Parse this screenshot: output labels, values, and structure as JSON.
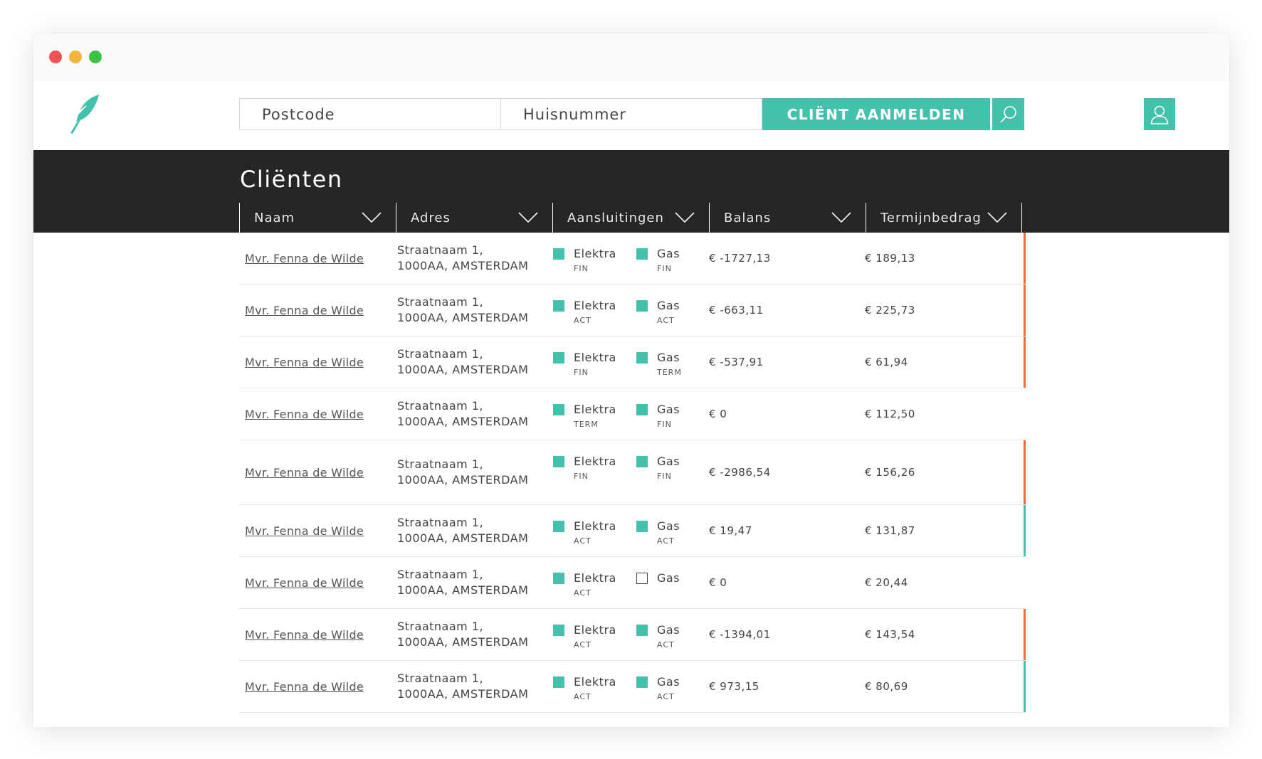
{
  "search": {
    "postcode_placeholder": "Postcode",
    "huisnummer_placeholder": "Huisnummer",
    "submit_label": "CLIËNT AANMELDEN"
  },
  "page": {
    "title": "Cliënten"
  },
  "columns": [
    "Naam",
    "Adres",
    "Aansluitingen",
    "Balans",
    "Termijnbedrag"
  ],
  "colors": {
    "brand": "#44c1aa",
    "negative_accent": "#f06a3c",
    "positive_accent": "#44c1aa",
    "dark_bar": "#262626"
  },
  "icons": {
    "logo": "feather-logo-icon",
    "search": "search-icon",
    "user": "user-icon",
    "sort": "chevron-down-icon",
    "connection": "status-square-icon"
  },
  "rows": [
    {
      "naam": "Mvr. Fenna de Wilde",
      "adres1": "Straatnaam 1,",
      "adres2": "1000AA, AMSTERDAM",
      "elektra": {
        "label": "Elektra",
        "status": "FIN",
        "active": true
      },
      "gas": {
        "label": "Gas",
        "status": "FIN",
        "active": true
      },
      "balans": "€ -1727,13",
      "termijn": "€ 189,13",
      "accent": "negative"
    },
    {
      "naam": "Mvr. Fenna de Wilde",
      "adres1": "Straatnaam 1,",
      "adres2": "1000AA, AMSTERDAM",
      "elektra": {
        "label": "Elektra",
        "status": "ACT",
        "active": true
      },
      "gas": {
        "label": "Gas",
        "status": "ACT",
        "active": true
      },
      "balans": "€ -663,11",
      "termijn": "€ 225,73",
      "accent": "negative"
    },
    {
      "naam": "Mvr. Fenna de Wilde",
      "adres1": "Straatnaam 1,",
      "adres2": "1000AA, AMSTERDAM",
      "elektra": {
        "label": "Elektra",
        "status": "FIN",
        "active": true
      },
      "gas": {
        "label": "Gas",
        "status": "TERM",
        "active": true
      },
      "balans": "€ -537,91",
      "termijn": "€ 61,94",
      "accent": "negative"
    },
    {
      "naam": "Mvr. Fenna de Wilde",
      "adres1": "Straatnaam 1,",
      "adres2": "1000AA, AMSTERDAM",
      "elektra": {
        "label": "Elektra",
        "status": "TERM",
        "active": true
      },
      "gas": {
        "label": "Gas",
        "status": "FIN",
        "active": true
      },
      "balans": "€ 0",
      "termijn": "€ 112,50",
      "accent": "none"
    },
    {
      "naam": "Mvr. Fenna de Wilde",
      "adres1": "Straatnaam 1,",
      "adres2": "1000AA, AMSTERDAM",
      "elektra": {
        "label": "Elektra",
        "status": "FIN",
        "active": true
      },
      "gas": {
        "label": "Gas",
        "status": "FIN",
        "active": true
      },
      "balans": "€ -2986,54",
      "termijn": "€ 156,26",
      "accent": "negative"
    },
    {
      "naam": "Mvr. Fenna de Wilde",
      "adres1": "Straatnaam 1,",
      "adres2": "1000AA, AMSTERDAM",
      "elektra": {
        "label": "Elektra",
        "status": "ACT",
        "active": true
      },
      "gas": {
        "label": "Gas",
        "status": "ACT",
        "active": true
      },
      "balans": "€ 19,47",
      "termijn": "€ 131,87",
      "accent": "positive"
    },
    {
      "naam": "Mvr. Fenna de Wilde",
      "adres1": "Straatnaam 1,",
      "adres2": "1000AA, AMSTERDAM",
      "elektra": {
        "label": "Elektra",
        "status": "ACT",
        "active": true
      },
      "gas": {
        "label": "Gas",
        "status": "",
        "active": false
      },
      "balans": "€ 0",
      "termijn": "€ 20,44",
      "accent": "none"
    },
    {
      "naam": "Mvr. Fenna de Wilde",
      "adres1": "Straatnaam 1,",
      "adres2": "1000AA, AMSTERDAM",
      "elektra": {
        "label": "Elektra",
        "status": "ACT",
        "active": true
      },
      "gas": {
        "label": "Gas",
        "status": "ACT",
        "active": true
      },
      "balans": "€ -1394,01",
      "termijn": "€ 143,54",
      "accent": "negative"
    },
    {
      "naam": "Mvr. Fenna de Wilde",
      "adres1": "Straatnaam 1,",
      "adres2": "1000AA, AMSTERDAM",
      "elektra": {
        "label": "Elektra",
        "status": "ACT",
        "active": true
      },
      "gas": {
        "label": "Gas",
        "status": "ACT",
        "active": true
      },
      "balans": "€ 973,15",
      "termijn": "€ 80,69",
      "accent": "positive"
    }
  ]
}
